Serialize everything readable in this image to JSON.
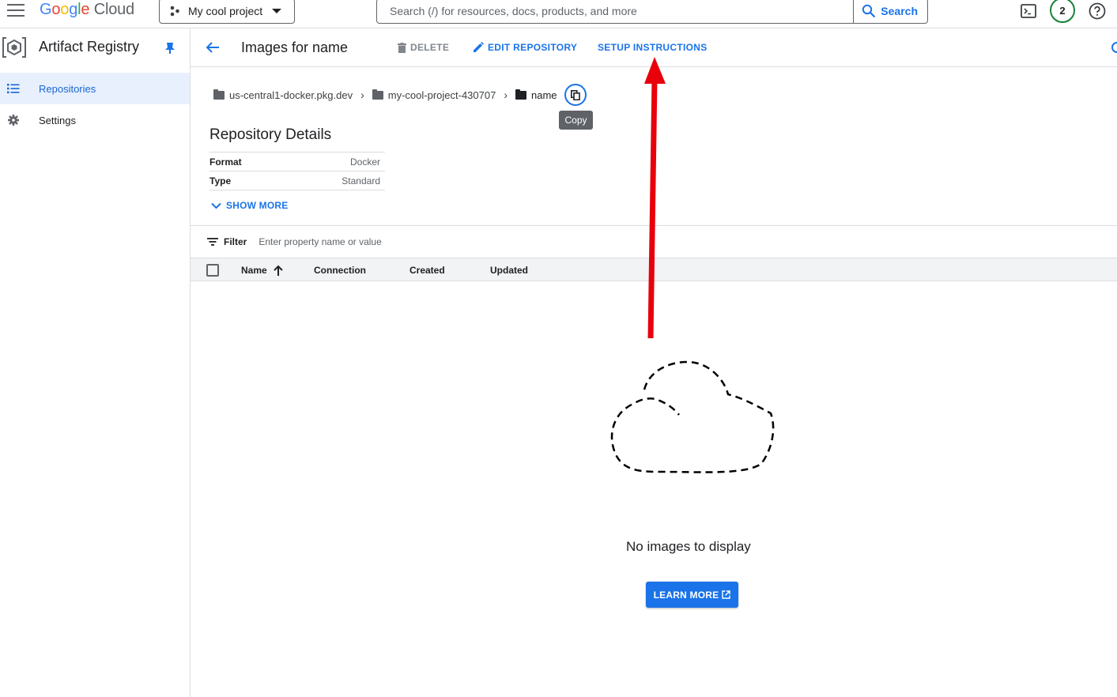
{
  "topbar": {
    "logo_google": "Google",
    "logo_cloud": "Cloud",
    "project_name": "My cool project",
    "search_placeholder": "Search (/) for resources, docs, products, and more",
    "search_button": "Search",
    "notification_count": "2"
  },
  "sidebar": {
    "title": "Artifact Registry",
    "items": [
      {
        "label": "Repositories",
        "icon": "list-icon",
        "active": true
      },
      {
        "label": "Settings",
        "icon": "gear-icon",
        "active": false
      }
    ]
  },
  "actionbar": {
    "title": "Images for name",
    "delete": "DELETE",
    "edit": "EDIT REPOSITORY",
    "setup": "SETUP INSTRUCTIONS"
  },
  "breadcrumb": {
    "location": "us-central1-docker.pkg.dev",
    "project": "my-cool-project-430707",
    "repo": "name",
    "tooltip": "Copy"
  },
  "details": {
    "title": "Repository Details",
    "rows": [
      {
        "key": "Format",
        "value": "Docker"
      },
      {
        "key": "Type",
        "value": "Standard"
      }
    ],
    "show_more": "SHOW MORE"
  },
  "filter": {
    "label": "Filter",
    "placeholder": "Enter property name or value"
  },
  "table": {
    "columns": [
      "Name",
      "Connection",
      "Created",
      "Updated"
    ]
  },
  "empty_state": {
    "message": "No images to display",
    "button": "LEARN MORE"
  },
  "colors": {
    "accent": "#1a73e8",
    "annotation_arrow": "#e8000b"
  }
}
